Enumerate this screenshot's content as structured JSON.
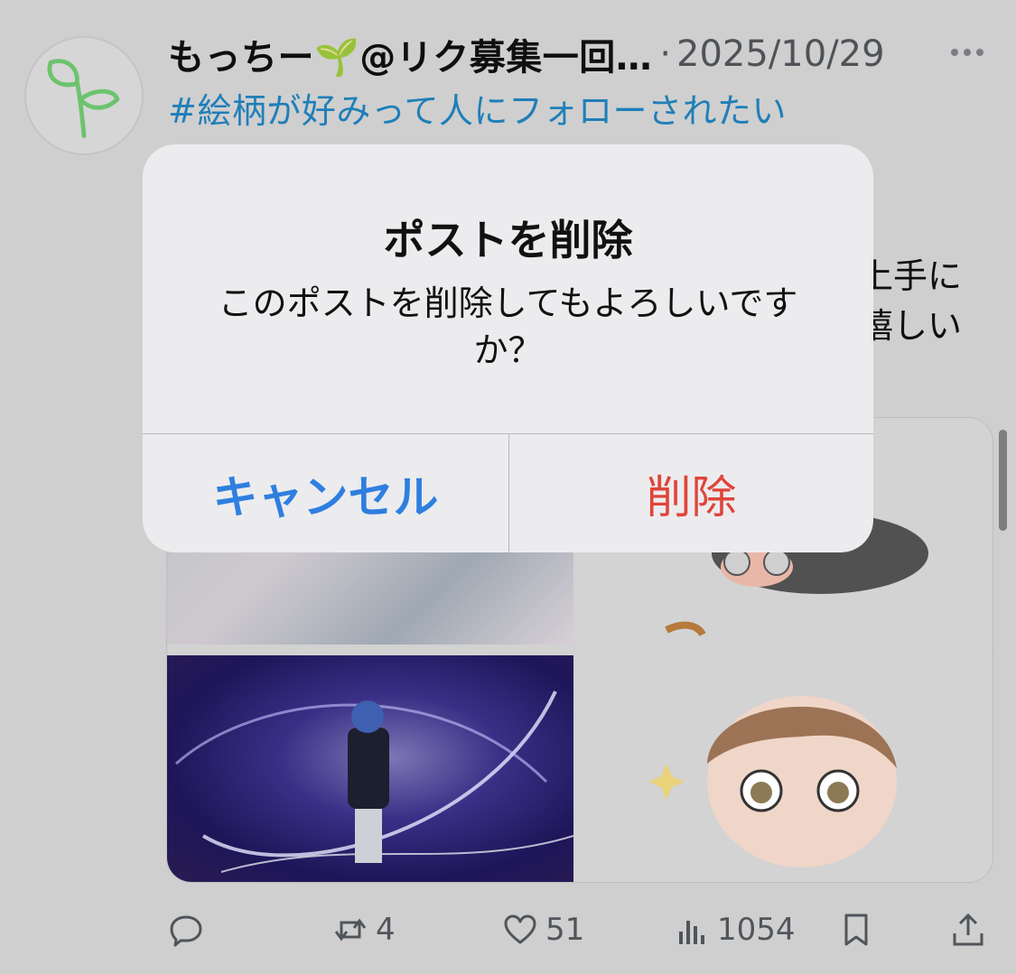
{
  "tweet": {
    "display_name": "もっちー🌱@リク募集一回…",
    "separator": "·",
    "date": "2025/10/29",
    "hashtag": "#絵柄が好みって人にフォローされたい",
    "right_fragment_1": "上手に",
    "right_fragment_2": "嬉しい"
  },
  "actions": {
    "retweets": "4",
    "likes": "51",
    "views": "1054"
  },
  "dialog": {
    "title": "ポストを削除",
    "message": "このポストを削除してもよろしいですか？",
    "cancel_label": "キャンセル",
    "delete_label": "削除"
  },
  "colors": {
    "link": "#1f7fb8",
    "cancel": "#2f7fe0",
    "destructive": "#e0443a"
  },
  "icons": [
    "more-icon",
    "reply-icon",
    "retweet-icon",
    "like-icon",
    "views-icon",
    "bookmark-icon",
    "share-icon"
  ]
}
